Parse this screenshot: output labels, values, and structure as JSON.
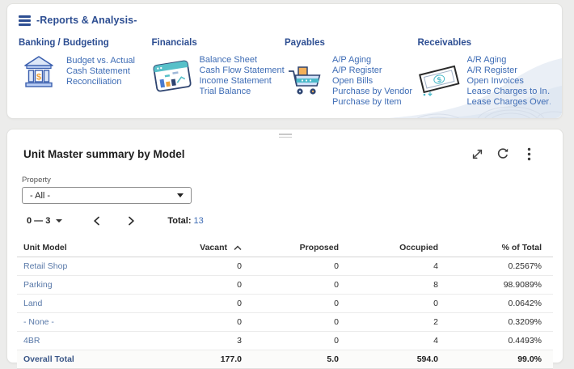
{
  "colors": {
    "navy_heading": "#2d4e92",
    "link_blue": "#3e6cb5",
    "table_link_blue": "#5878a8",
    "total_navy": "#3a5687",
    "teal_accent": "#49b9c9",
    "orange_accent": "#f0a33c",
    "bar_blue": "#4a7bd0",
    "card_bg": "#ffffff",
    "page_bg": "#ececeb"
  },
  "icons": {
    "menu": "hamburger-icon",
    "banking": "bank-icon",
    "financials": "chart-window-icon",
    "payables": "shopping-cart-icon",
    "receivables": "banknote-icon",
    "expand": "expand-icon",
    "refresh": "refresh-icon",
    "more": "kebab-menu-icon",
    "sort": "sort-ascending-icon",
    "prev": "chevron-left-icon",
    "next": "chevron-right-icon",
    "dropdown": "caret-down-icon",
    "drag": "drag-handle"
  },
  "reports_panel": {
    "title": "-Reports & Analysis-",
    "categories": [
      {
        "name": "Banking / Budgeting",
        "icon": "bank-icon",
        "links": [
          "Budget vs. Actual",
          "Cash Statement",
          "Reconciliation"
        ]
      },
      {
        "name": "Financials",
        "icon": "chart-window-icon",
        "links": [
          "Balance Sheet",
          "Cash Flow Statement",
          "Income Statement",
          "Trial Balance"
        ]
      },
      {
        "name": "Payables",
        "icon": "shopping-cart-icon",
        "links": [
          "A/P Aging",
          "A/P Register",
          "Open Bills",
          "Purchase by Vendor",
          "Purchase by Item"
        ]
      },
      {
        "name": "Receivables",
        "icon": "banknote-icon",
        "links": [
          "A/R Aging",
          "A/R Register",
          "Open Invoices",
          "Lease Charges to In…",
          "Lease Charges Over…"
        ]
      }
    ]
  },
  "unit_panel": {
    "title": "Unit Master summary by Model",
    "property": {
      "label": "Property",
      "value": "- All -"
    },
    "pagination": {
      "range": "0 — 3",
      "total_label": "Total:",
      "total_value": "13"
    },
    "table": {
      "columns": [
        "Unit Model",
        "Vacant",
        "Proposed",
        "Occupied",
        "% of Total"
      ],
      "sorted_column": "Vacant",
      "sort_direction": "ascending",
      "rows": [
        {
          "model": "Retail Shop",
          "vacant": "0",
          "proposed": "0",
          "occupied": "4",
          "pct": "0.2567%"
        },
        {
          "model": "Parking",
          "vacant": "0",
          "proposed": "0",
          "occupied": "8",
          "pct": "98.9089%"
        },
        {
          "model": "Land",
          "vacant": "0",
          "proposed": "0",
          "occupied": "0",
          "pct": "0.0642%"
        },
        {
          "model": "- None -",
          "vacant": "0",
          "proposed": "0",
          "occupied": "2",
          "pct": "0.3209%"
        },
        {
          "model": "4BR",
          "vacant": "3",
          "proposed": "0",
          "occupied": "4",
          "pct": "0.4493%"
        }
      ],
      "total_row": {
        "model": "Overall Total",
        "vacant": "177.0",
        "proposed": "5.0",
        "occupied": "594.0",
        "pct": "99.0%"
      }
    }
  }
}
